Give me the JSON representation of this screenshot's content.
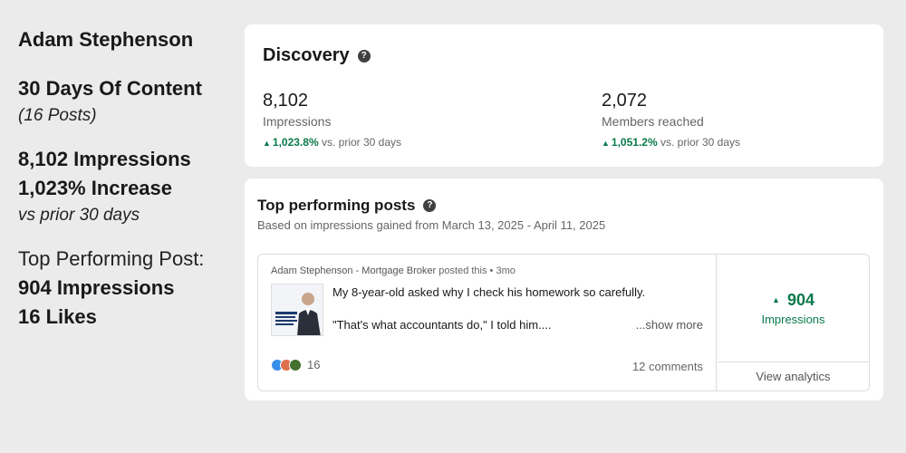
{
  "summary": {
    "name": "Adam Stephenson",
    "heading": "30 Days Of Content",
    "posts": "(16 Posts)",
    "impressions": "8,102 Impressions",
    "increase": "1,023% Increase",
    "vs": "vs prior 30 days",
    "top_label": "Top Performing Post:",
    "top_impressions": "904 Impressions",
    "top_likes": "16 Likes"
  },
  "discovery": {
    "title": "Discovery",
    "help_icon": "question-circle-icon",
    "impressions": {
      "value": "8,102",
      "label": "Impressions",
      "change_pct": "1,023.8%",
      "change_text": "vs. prior 30 days"
    },
    "members": {
      "value": "2,072",
      "label": "Members reached",
      "change_pct": "1,051.2%",
      "change_text": "vs. prior 30 days"
    }
  },
  "top_posts": {
    "title": "Top performing posts",
    "subtitle": "Based on impressions gained from March 13, 2025 - April 11, 2025",
    "post": {
      "author": "Adam Stephenson - Mortgage Broker",
      "meta": "posted this • 3mo",
      "line1": "My 8-year-old asked why I check his homework so carefully.",
      "line2": "\"That's what accountants do,\" I told him....",
      "show_more": "...show more",
      "reaction_count": "16",
      "comments": "12 comments",
      "impressions_value": "904",
      "impressions_label": "Impressions",
      "view_analytics": "View analytics"
    }
  },
  "colors": {
    "positive": "#0a7a4a",
    "background": "#ebebeb",
    "card": "#ffffff"
  }
}
